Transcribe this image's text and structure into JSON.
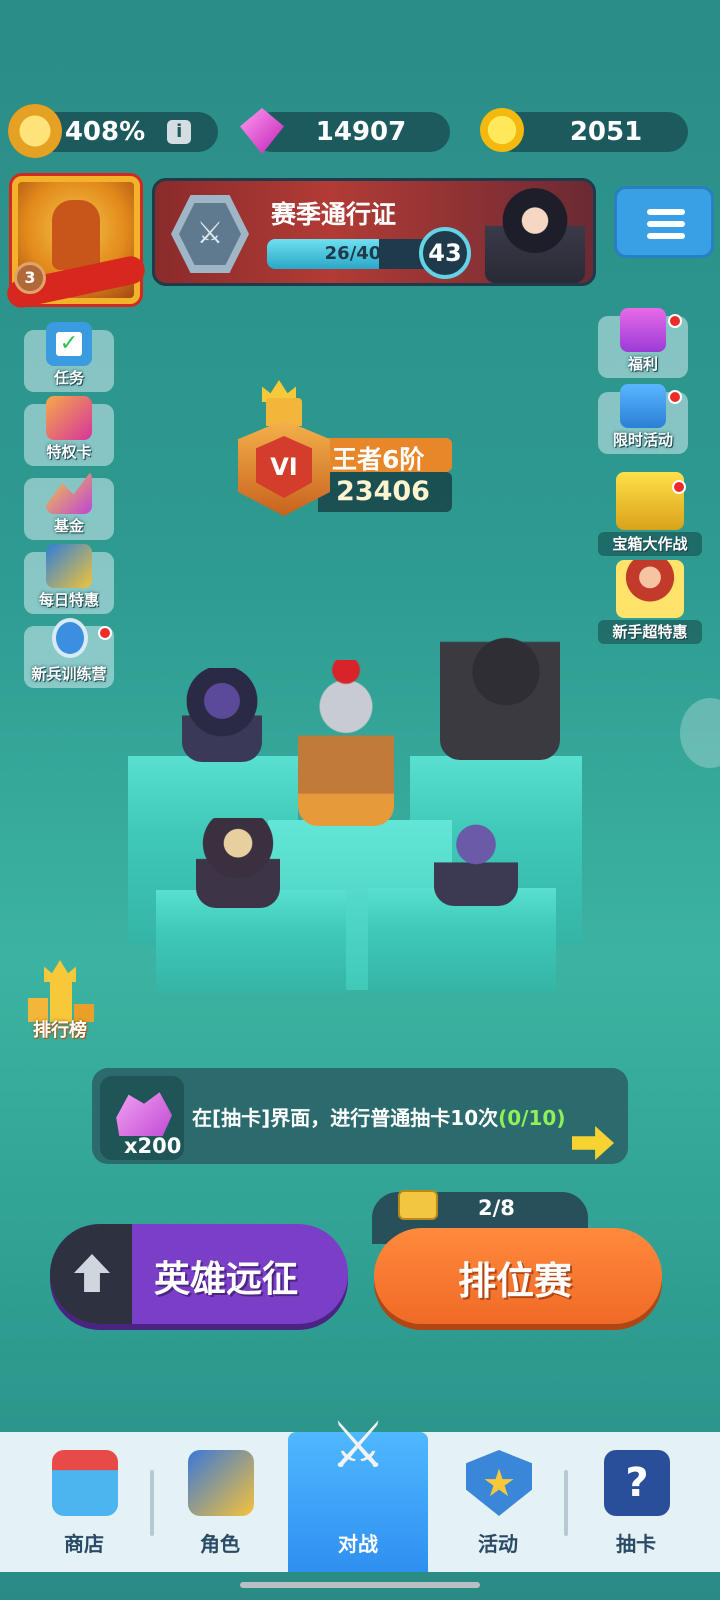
{
  "resources": {
    "power": "408%",
    "gems": "14907",
    "coins": "2051"
  },
  "avatar": {
    "level": "3"
  },
  "season_pass": {
    "title": "赛季通行证",
    "progress_text": "26/40",
    "progress_fraction": 0.65,
    "level": "43"
  },
  "left_menu": {
    "tasks": "任务",
    "privilege_card": "特权卡",
    "fund": "基金",
    "daily_deal": "每日特惠",
    "recruit_camp": "新兵训练营"
  },
  "right_menu": {
    "welfare": "福利",
    "limited_event": "限时活动",
    "chest_battle": "宝箱大作战",
    "newbie_deal": "新手超特惠"
  },
  "rank": {
    "emblem": "VI",
    "title": "王者6阶",
    "score": "23406"
  },
  "leaderboard_label": "排行榜",
  "quest": {
    "reward_qty": "x200",
    "text": "在[抽卡]界面，进行普通抽卡10次",
    "progress": "(0/10)"
  },
  "ticket_count": "2/8",
  "buttons": {
    "expedition": "英雄远征",
    "ranked": "排位赛"
  },
  "nav": {
    "shop": "商店",
    "character": "角色",
    "battle": "对战",
    "activity": "活动",
    "gacha": "抽卡"
  },
  "colors": {
    "background": "#2e9a90",
    "expedition": "#7b3fc7",
    "ranked": "#f06a26",
    "nav_active": "#2f8ff0"
  }
}
